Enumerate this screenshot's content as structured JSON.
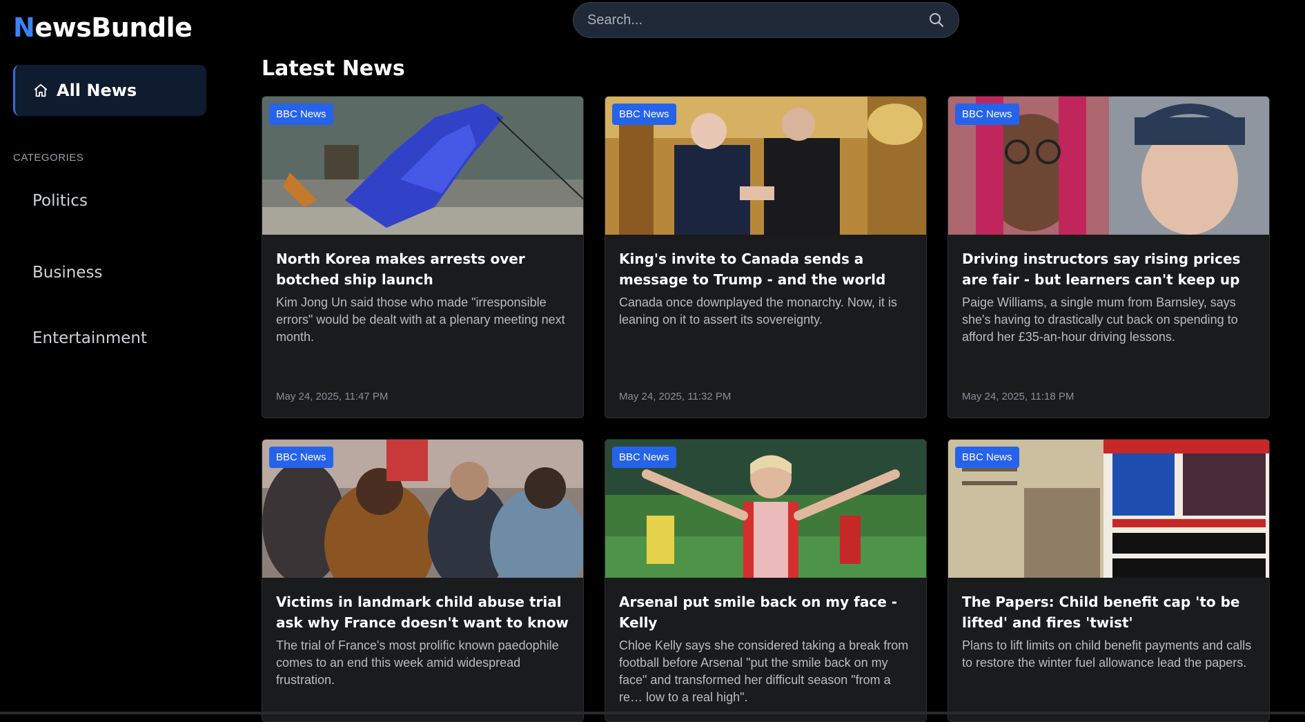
{
  "app": {
    "logo_first": "N",
    "logo_rest": "ewsBundle"
  },
  "sidebar": {
    "active_item": "All News",
    "categories_heading": "CATEGORIES",
    "categories": [
      "Politics",
      "Business",
      "Entertainment"
    ]
  },
  "search": {
    "placeholder": "Search..."
  },
  "main": {
    "title": "Latest News",
    "articles": [
      {
        "source": "BBC News",
        "title": "North Korea makes arrests over botched ship launch",
        "description": "Kim Jong Un said those who made \"irresponsible errors\" would be dealt with at a plenary meeting next month.",
        "date": "May 24, 2025, 11:47 PM"
      },
      {
        "source": "BBC News",
        "title": "King's invite to Canada sends a message to Trump - and the world",
        "description": "Canada once downplayed the monarchy. Now, it is leaning on it to assert its sovereignty.",
        "date": "May 24, 2025, 11:32 PM"
      },
      {
        "source": "BBC News",
        "title": "Driving instructors say rising prices are fair - but learners can't keep up",
        "description": "Paige Williams, a single mum from Barnsley, says she's having to drastically cut back on spending to afford her £35-an-hour driving lessons.",
        "date": "May 24, 2025, 11:18 PM"
      },
      {
        "source": "BBC News",
        "title": "Victims in landmark child abuse trial ask why France doesn't want to know",
        "description": "The trial of France's most prolific known paedophile comes to an end this week amid widespread frustration.",
        "date": ""
      },
      {
        "source": "BBC News",
        "title": "Arsenal put smile back on my face - Kelly",
        "description": "Chloe Kelly says she considered taking a break from football before Arsenal \"put the smile back on my face\" and transformed her difficult season \"from a re… low to a real high\".",
        "date": ""
      },
      {
        "source": "BBC News",
        "title": "The Papers: Child benefit cap 'to be lifted' and fires 'twist'",
        "description": "Plans to lift limits on child benefit payments and calls to restore the winter fuel allowance lead the papers.",
        "date": ""
      }
    ]
  },
  "colors": {
    "accent": "#3b82f6",
    "badge": "#2563eb",
    "background": "#000000",
    "card": "#1a1b1d",
    "nav_active": "#0f1b2e"
  }
}
